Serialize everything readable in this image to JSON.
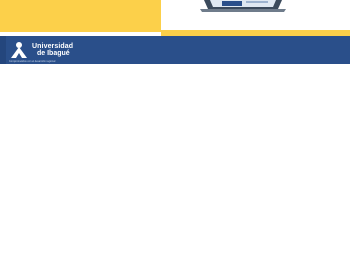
{
  "brand": {
    "name_line1": "Universidad",
    "name_line2": "de Ibagué",
    "tagline": "Comprometidos con el desarrollo regional",
    "colors": {
      "yellow": "#fcd04a",
      "blue": "#2a4f8a",
      "white": "#ffffff"
    }
  },
  "icons": {
    "logo": "university-logo-icon",
    "banner_image": "laptop-icon"
  }
}
